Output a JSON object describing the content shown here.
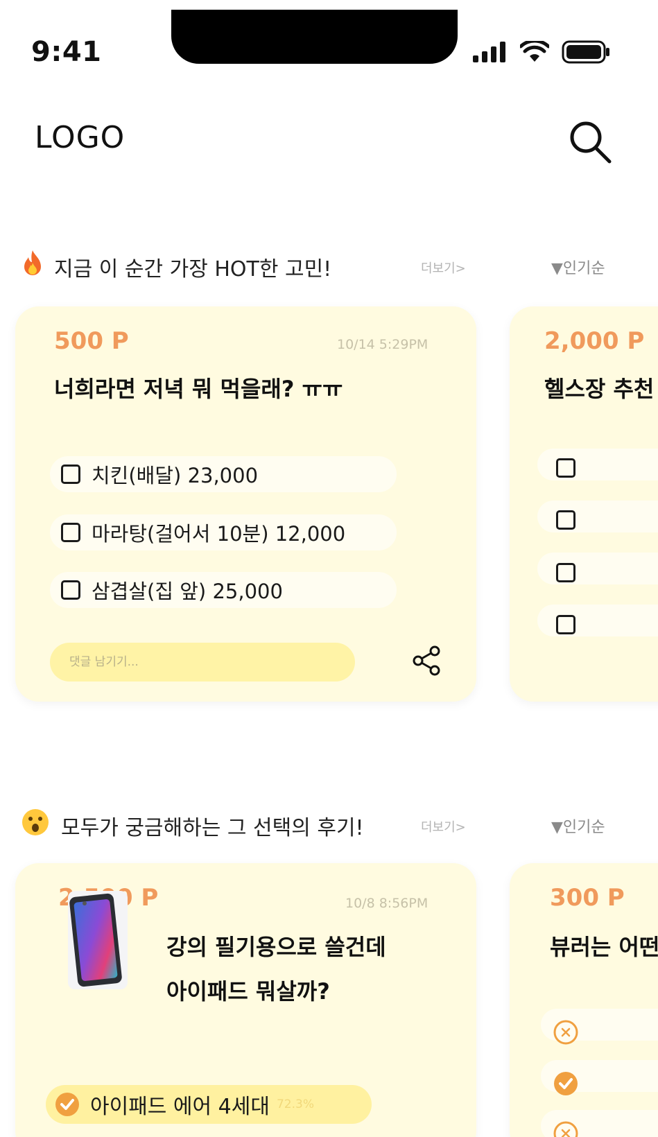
{
  "status_bar": {
    "time": "9:41"
  },
  "header": {
    "logo": "LOGO"
  },
  "section_hot": {
    "title": "지금 이 순간 가장 HOT한 고민!",
    "more": "더보기>",
    "sort": "▼인기순",
    "emoji_icon": "fire-icon",
    "cards": [
      {
        "points": "500 P",
        "date": "10/14 5:29PM",
        "question": "너희라면 저녁 뭐 먹을래? ㅠㅠ",
        "options": [
          {
            "label": "치킨(배달) 23,000"
          },
          {
            "label": "마라탕(걸어서 10분) 12,000"
          },
          {
            "label": "삼겹살(집 앞) 25,000"
          }
        ],
        "comment_placeholder": "댓글 남기기..."
      },
      {
        "points": "2,000 P",
        "question": "헬스장 추천"
      }
    ]
  },
  "section_review": {
    "title": "모두가 궁금해하는 그 선택의 후기!",
    "more": "더보기>",
    "sort": "▼인기순",
    "emoji_icon": "surprised-face-icon",
    "cards": [
      {
        "points": "2,500 P",
        "date": "10/8 8:56PM",
        "question_line1": "강의 필기용으로 쓸건데",
        "question_line2": "아이패드 뭐살까?",
        "result": {
          "label": "아이패드 에어 4세대",
          "percent": "72.3%"
        }
      },
      {
        "points": "300 P",
        "question": "뷰러는 어떤"
      }
    ]
  },
  "colors": {
    "card_bg": "#fffbe0",
    "points": "#f09a5c",
    "comment_bg": "#fff3a6",
    "accent_check": "#f0a040"
  }
}
